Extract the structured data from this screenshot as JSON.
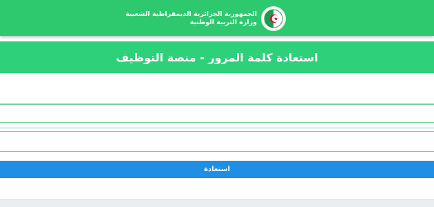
{
  "header": {
    "line1": "الجمهورية الجزائرية الديمقراطية الشعبية",
    "line2": "وزارة التربية الوطنية",
    "logo_icon": "algeria-emblem-icon",
    "bar_color": "#2ec96f"
  },
  "page": {
    "title": "استعادة كلمة المرور - منصة التوظيف",
    "title_band_color": "#2ed07a"
  },
  "form": {
    "field1_value": "",
    "field2_value": "",
    "field3_value": "",
    "submit_label": "استعادة",
    "submit_color": "#1f8fe6"
  }
}
